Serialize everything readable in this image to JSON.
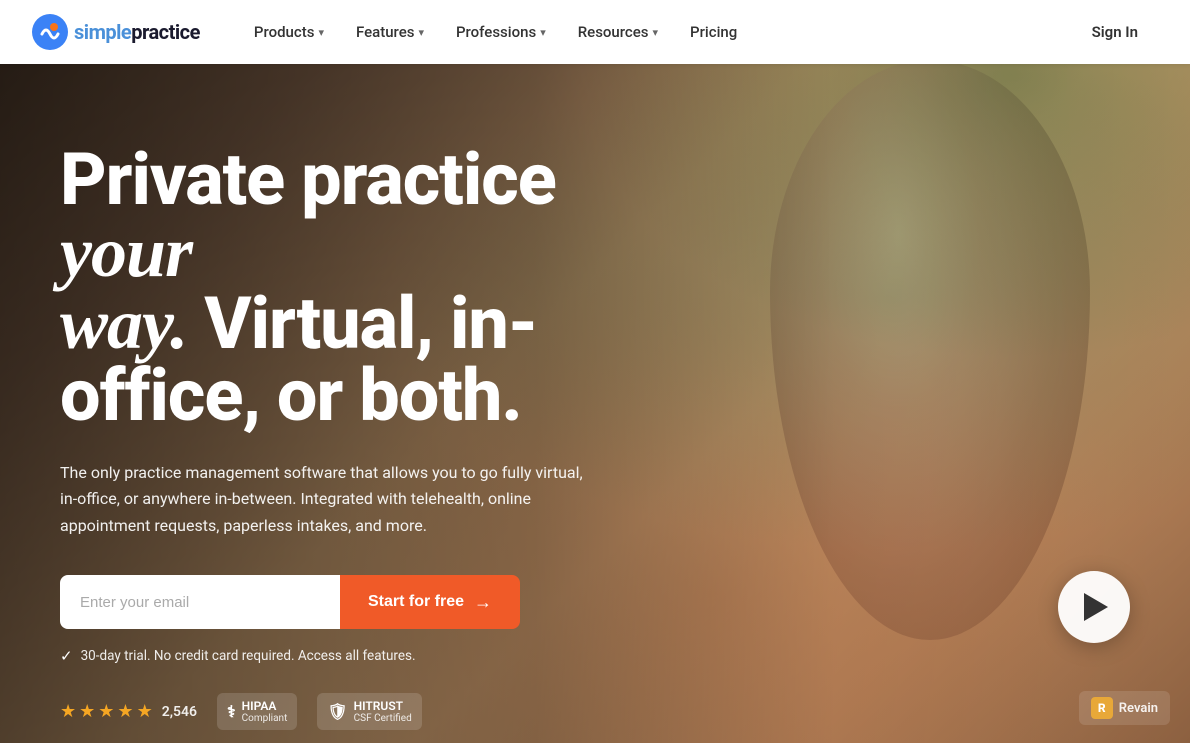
{
  "nav": {
    "logo_text": "simplepractice",
    "items": [
      {
        "label": "Products",
        "has_dropdown": true
      },
      {
        "label": "Features",
        "has_dropdown": true
      },
      {
        "label": "Professions",
        "has_dropdown": true
      },
      {
        "label": "Resources",
        "has_dropdown": true
      },
      {
        "label": "Pricing",
        "has_dropdown": false
      }
    ],
    "sign_in": "Sign In"
  },
  "hero": {
    "headline_part1": "Private practice ",
    "headline_italic": "your",
    "headline_part2": "way.",
    "headline_part3": " Virtual, in-office, or both.",
    "subtext": "The only practice management software that allows you to go fully virtual, in-office, or anywhere in-between. Integrated with telehealth, online appointment requests, paperless intakes, and more.",
    "email_placeholder": "Enter your email",
    "cta_button": "Start for free",
    "trial_text": "30-day trial. No credit card required. Access all features.",
    "rating_count": "2,546",
    "hipaa_label": "HIPAA",
    "hipaa_sub": "Compliant",
    "hitrust_label": "HITRUST",
    "hitrust_sub": "CSF Certified",
    "revain_text": "Revain"
  }
}
